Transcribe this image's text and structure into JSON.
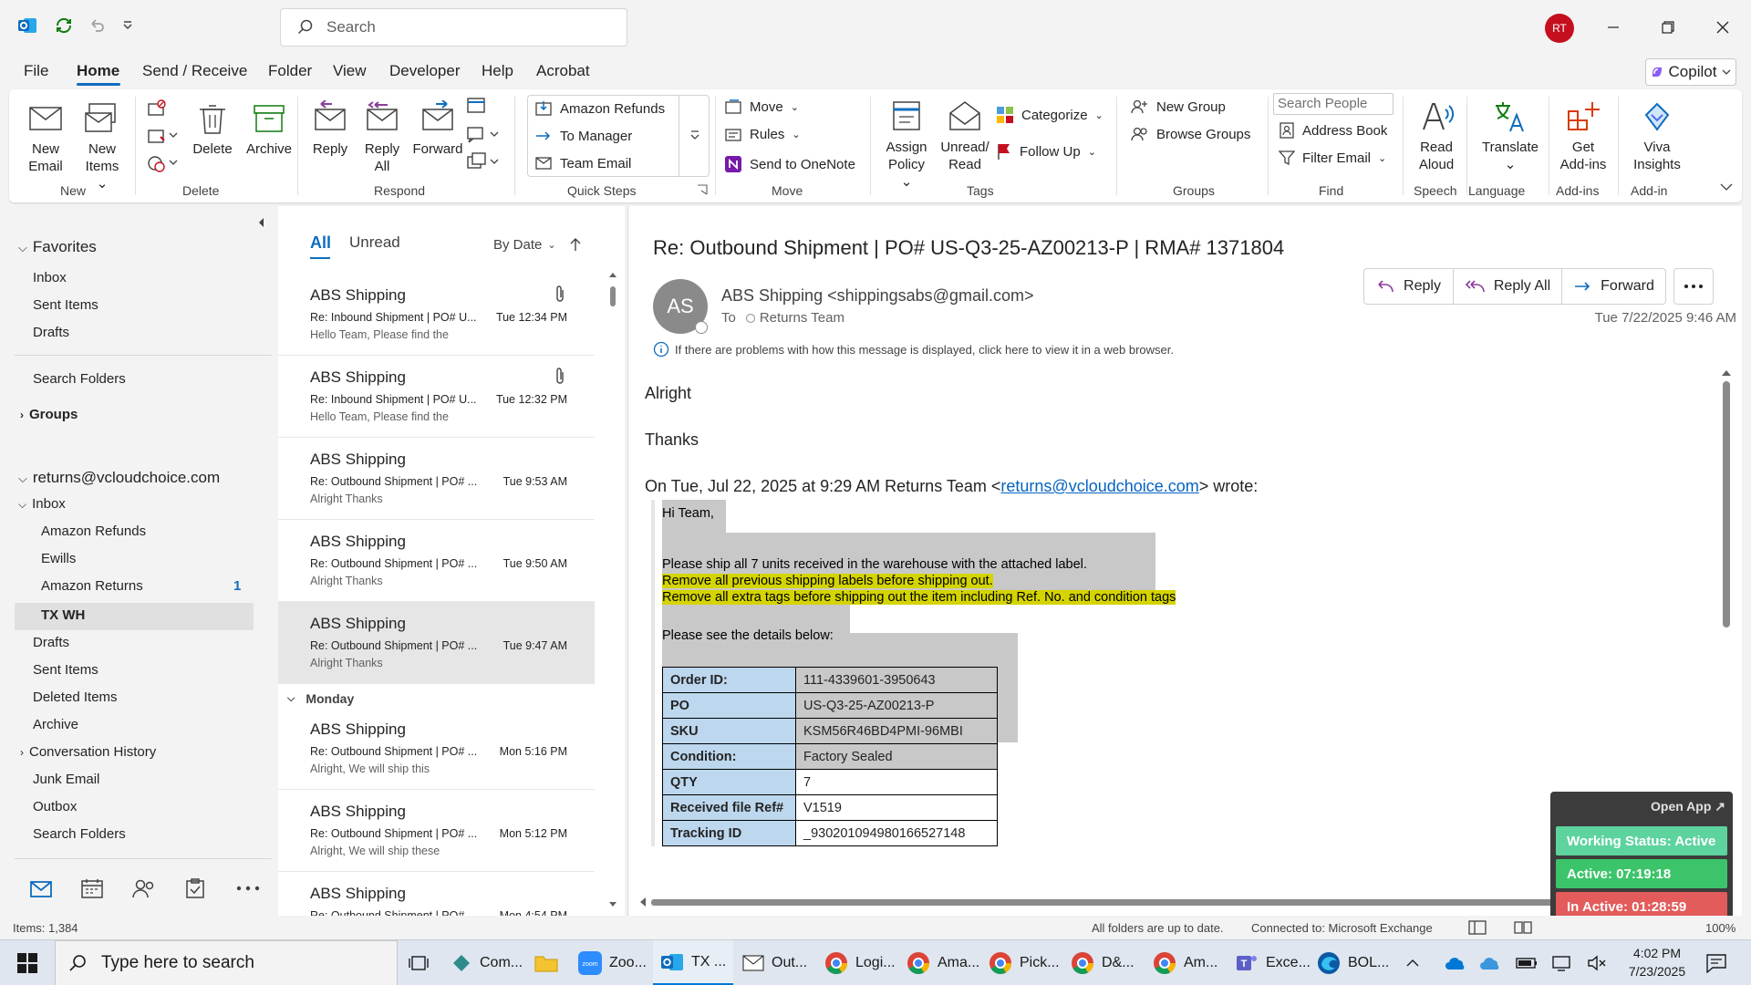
{
  "titlebar": {
    "search_placeholder": "Search",
    "avatar_initials": "RT"
  },
  "menu": {
    "items": [
      "File",
      "Home",
      "Send / Receive",
      "Folder",
      "View",
      "Developer",
      "Help",
      "Acrobat"
    ],
    "copilot": "Copilot"
  },
  "ribbon": {
    "new_email": [
      "New",
      "Email"
    ],
    "new_items": [
      "New",
      "Items"
    ],
    "delete": "Delete",
    "archive": "Archive",
    "reply": "Reply",
    "reply_all": [
      "Reply",
      "All"
    ],
    "forward": "Forward",
    "quick_steps": [
      "Amazon Refunds",
      "To Manager",
      "Team Email"
    ],
    "move": "Move",
    "rules": "Rules",
    "onenote": "Send to OneNote",
    "assign_policy": [
      "Assign",
      "Policy"
    ],
    "unread_read": [
      "Unread/",
      "Read"
    ],
    "categorize": "Categorize",
    "follow_up": "Follow Up",
    "new_group": "New Group",
    "browse_groups": "Browse Groups",
    "search_people": "Search People",
    "address_book": "Address Book",
    "filter_email": "Filter Email",
    "read_aloud": [
      "Read",
      "Aloud"
    ],
    "translate": "Translate",
    "get_addins": [
      "Get",
      "Add-ins"
    ],
    "viva": [
      "Viva",
      "Insights"
    ],
    "groups": [
      "New",
      "Delete",
      "Respond",
      "Quick Steps",
      "Move",
      "Tags",
      "Groups",
      "Find",
      "Speech",
      "Language",
      "Add-ins",
      "Add-in"
    ]
  },
  "folders": {
    "favorites": "Favorites",
    "fav_items": [
      "Inbox",
      "Sent Items",
      "Drafts"
    ],
    "search_folders": "Search Folders",
    "groups": "Groups",
    "account": "returns@vcloudchoice.com",
    "inbox": "Inbox",
    "subfolders": [
      "Amazon Refunds",
      "Ewills",
      "Amazon Returns",
      "TX WH"
    ],
    "amazon_returns_count": "1",
    "others": [
      "Drafts",
      "Sent Items",
      "Deleted Items",
      "Archive",
      "Conversation History",
      "Junk Email",
      "Outbox",
      "Search Folders"
    ]
  },
  "list": {
    "tab_all": "All",
    "tab_unread": "Unread",
    "sort": "By Date",
    "group_monday": "Monday",
    "messages": [
      {
        "sender": "ABS Shipping",
        "subject": "Re: Inbound Shipment | PO# U...",
        "time": "Tue 12:34 PM",
        "preview": "Hello Team,  Please find the"
      },
      {
        "sender": "ABS Shipping",
        "subject": "Re: Inbound Shipment | PO# U...",
        "time": "Tue 12:32 PM",
        "preview": "Hello Team,  Please find the"
      },
      {
        "sender": "ABS Shipping",
        "subject": "Re: Outbound Shipment | PO# ...",
        "time": "Tue 9:53 AM",
        "preview": "Alright  Thanks"
      },
      {
        "sender": "ABS Shipping",
        "subject": "Re: Outbound Shipment | PO# ...",
        "time": "Tue 9:50 AM",
        "preview": "Alright  Thanks"
      },
      {
        "sender": "ABS Shipping",
        "subject": "Re: Outbound Shipment | PO# ...",
        "time": "Tue 9:47 AM",
        "preview": "Alright  Thanks"
      },
      {
        "sender": "ABS Shipping",
        "subject": "Re: Outbound Shipment | PO# ...",
        "time": "Mon 5:16 PM",
        "preview": "Alright,  We will ship this"
      },
      {
        "sender": "ABS Shipping",
        "subject": "Re: Outbound Shipment | PO# ...",
        "time": "Mon 5:12 PM",
        "preview": "Alright,  We will ship these"
      },
      {
        "sender": "ABS Shipping",
        "subject": "Re: Outbound Shipment | PO# ...",
        "time": "Mon 4:54 PM",
        "preview": ""
      }
    ]
  },
  "reading": {
    "subject": "Re: Outbound Shipment | PO# US-Q3-25-AZ00213-P | RMA# 1371804",
    "avatar": "AS",
    "from": "ABS Shipping <shippingsabs@gmail.com>",
    "to_label": "To",
    "to": "Returns Team",
    "date": "Tue 7/22/2025 9:46 AM",
    "info": "If there are problems with how this message is displayed, click here to view it in a web browser.",
    "reply": "Reply",
    "reply_all": "Reply All",
    "forward": "Forward",
    "body_line1": "Alright",
    "body_line2": "Thanks",
    "quote_header_pre": "On Tue, Jul 22, 2025 at 9:29 AM Returns Team <",
    "quote_header_link": "returns@vcloudchoice.com",
    "quote_header_post": "> wrote:",
    "q_greeting": "Hi Team,",
    "q_line1": "Please ship all 7 units received in the warehouse with the attached label.",
    "q_line2": "Remove all previous shipping labels before shipping out.",
    "q_line3": "Remove all extra tags before shipping out the item including Ref. No. and condition tags",
    "q_details": "Please see the details below:",
    "table": [
      {
        "k": "Order ID:",
        "v": "111-4339601-3950643"
      },
      {
        "k": "PO",
        "v": "US-Q3-25-AZ00213-P"
      },
      {
        "k": "SKU",
        "v": "KSM56R46BD4PMI-96MBI"
      },
      {
        "k": "Condition:",
        "v": "Factory Sealed"
      },
      {
        "k": "QTY",
        "v": "7"
      },
      {
        "k": "Received file Ref#",
        "v": "V1519"
      },
      {
        "k": "Tracking ID",
        "v": "_930201094980166527148"
      }
    ]
  },
  "widget": {
    "open_app": "Open App ↗",
    "status": "Working Status: Active",
    "active": "Active: 07:19:18",
    "inactive": "In Active: 01:28:59"
  },
  "status": {
    "items": "Items: 1,384",
    "sync": "All folders are up to date.",
    "connected": "Connected to: Microsoft Exchange",
    "zoom": "100%"
  },
  "taskbar": {
    "search": "Type here to search",
    "apps": [
      "Com...",
      "Zoo...",
      "TX ...",
      "Out...",
      "Logi...",
      "Ama...",
      "Pick...",
      "D&...",
      "Am...",
      "Exce...",
      "BOL..."
    ],
    "time": "4:02 PM",
    "date": "7/23/2025"
  }
}
